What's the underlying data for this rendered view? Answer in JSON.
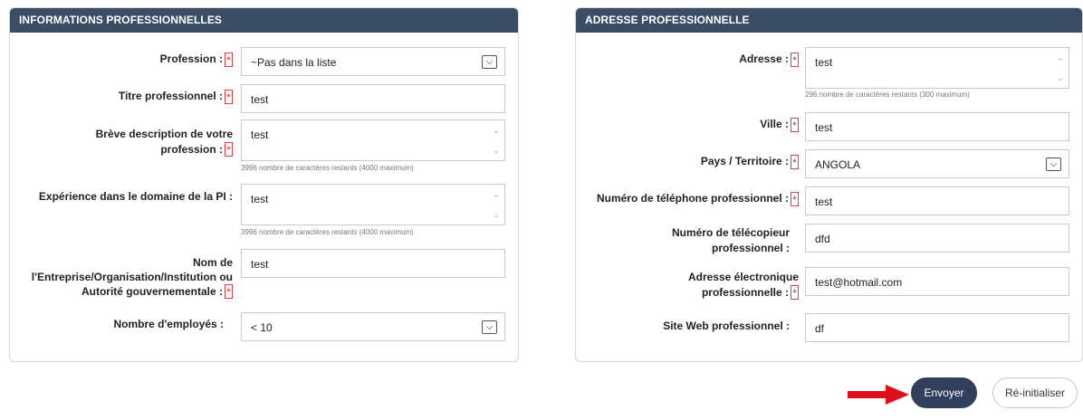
{
  "left_panel": {
    "title": "INFORMATIONS PROFESSIONNELLES",
    "profession": {
      "label": "Profession :",
      "value": "~Pas dans la liste"
    },
    "titre": {
      "label": "Titre professionnel :",
      "value": "test"
    },
    "description": {
      "label_line1": "Brève description de votre",
      "label_line2": "profession :",
      "value": "test",
      "hint": "3996 nombre de caractères restants (4000 maximum)"
    },
    "experience": {
      "label": "Expérience dans le domaine de la PI :",
      "value": "test",
      "hint": "3996 nombre de caractères restants (4000 maximum)"
    },
    "entreprise": {
      "label_line1": "Nom de",
      "label_line2": "l'Entreprise/Organisation/Institution ou",
      "label_line3": "Autorité gouvernementale :",
      "value": "test"
    },
    "employes": {
      "label": "Nombre d'employés :",
      "value": "< 10"
    }
  },
  "right_panel": {
    "title": "ADRESSE PROFESSIONNELLE",
    "adresse": {
      "label": "Adresse :",
      "value": "test",
      "hint": "296 nombre de caractères restants (300 maximum)"
    },
    "ville": {
      "label": "Ville :",
      "value": "test"
    },
    "pays": {
      "label": "Pays / Territoire :",
      "value": "ANGOLA"
    },
    "telephone": {
      "label": "Numéro de téléphone professionnel :",
      "value": "test"
    },
    "telecopieur": {
      "label_line1": "Numéro de télécopieur",
      "label_line2": "professionnel :",
      "value": "dfd"
    },
    "email": {
      "label_line1": "Adresse électronique",
      "label_line2": "professionnelle :",
      "value": "test@hotmail.com"
    },
    "site": {
      "label": "Site Web professionnel :",
      "value": "df"
    }
  },
  "actions": {
    "submit_label": "Envoyer",
    "reset_label": "Ré-initialiser"
  },
  "icons": {
    "required": "asterisk-box-icon",
    "dropdown": "chevron-down-icon",
    "scroll": "scroll-arrows-icon",
    "pointer": "red-arrow-icon"
  },
  "colors": {
    "header": "#3b4c66",
    "submit": "#2f3f5c",
    "required": "#e23b3b",
    "pointer": "#e0101a"
  }
}
